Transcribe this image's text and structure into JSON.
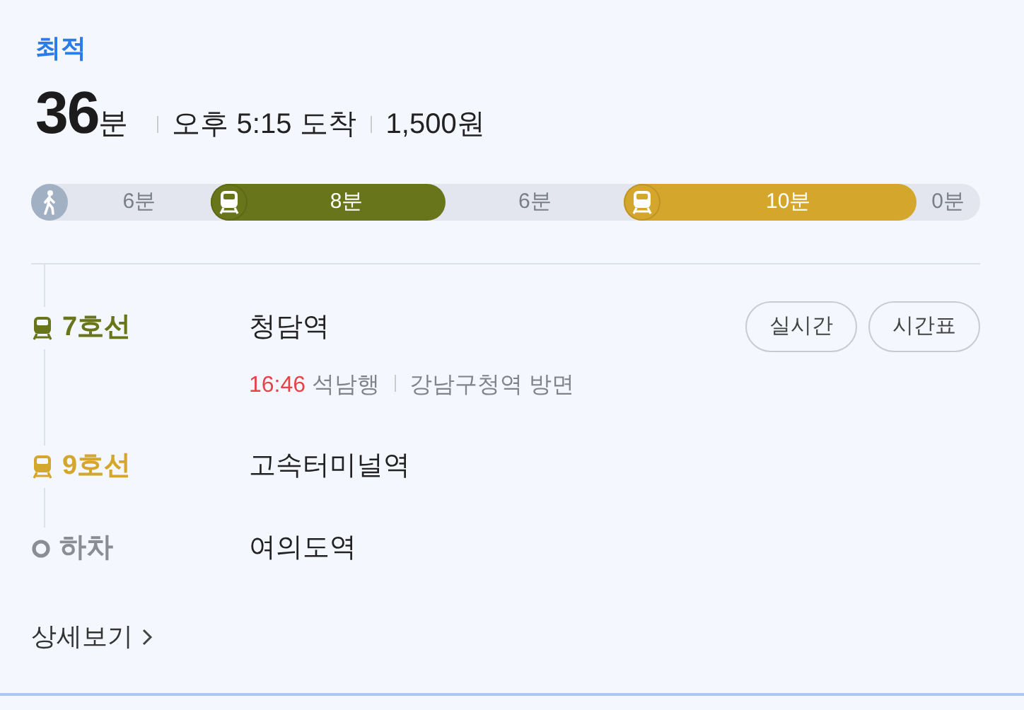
{
  "badge": "최적",
  "summary": {
    "duration": "36",
    "duration_unit": "분",
    "arrival": "오후 5:15 도착",
    "fare": "1,500원"
  },
  "segments": [
    {
      "kind": "walk",
      "label": "6분"
    },
    {
      "kind": "subway",
      "label": "8분",
      "color": "#69751a"
    },
    {
      "kind": "wait",
      "label": "6분"
    },
    {
      "kind": "subway",
      "label": "10분",
      "color": "#d4a62b"
    },
    {
      "kind": "wait",
      "label": "0분"
    }
  ],
  "steps": [
    {
      "kind": "line",
      "line": "7호선",
      "color": "#69751a",
      "station": "청담역",
      "departure": "16:46",
      "direction": "석남행",
      "platform": "강남구청역 방면",
      "buttons": [
        "실시간",
        "시간표"
      ]
    },
    {
      "kind": "line",
      "line": "9호선",
      "color": "#d4a62b",
      "station": "고속터미널역"
    },
    {
      "kind": "exit",
      "line": "하차",
      "station": "여의도역"
    }
  ],
  "details_link": "상세보기"
}
